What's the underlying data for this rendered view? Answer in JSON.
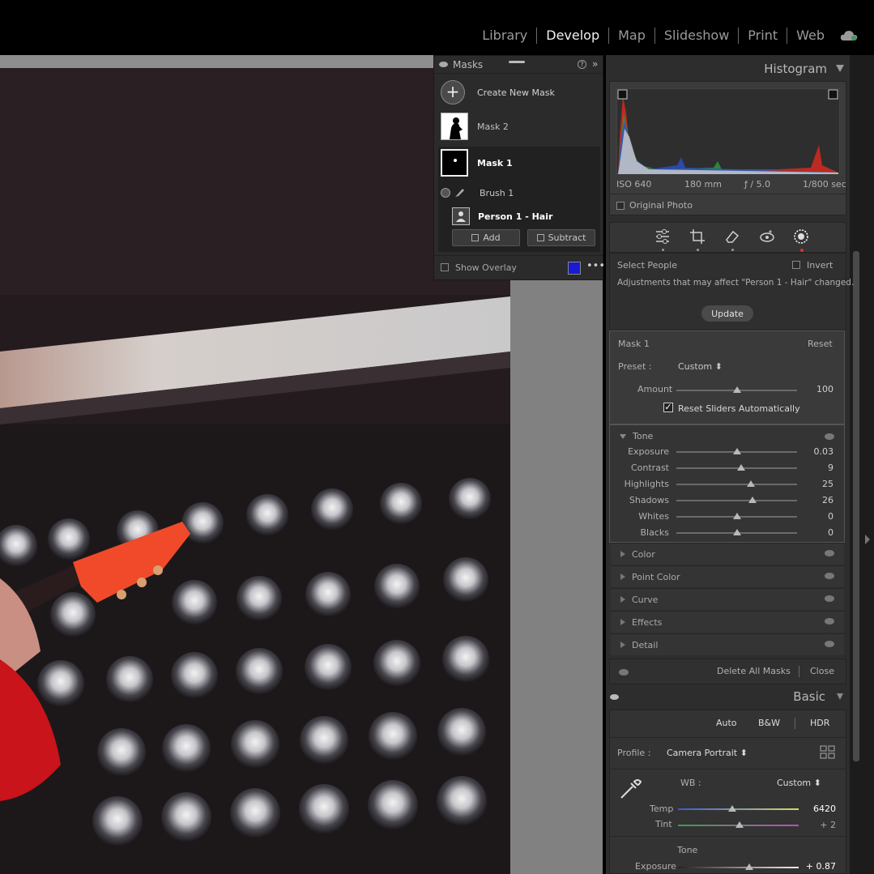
{
  "modules": [
    "Library",
    "Develop",
    "Map",
    "Slideshow",
    "Print",
    "Web"
  ],
  "active_module": "Develop",
  "masks_panel": {
    "title": "Masks",
    "create_label": "Create New Mask",
    "mask2": "Mask 2",
    "mask1": "Mask 1",
    "brush": "Brush 1",
    "person": "Person 1 - Hair",
    "add": "Add",
    "subtract": "Subtract",
    "show_overlay": "Show Overlay",
    "overlay_color": "#1a1ad0"
  },
  "histogram": {
    "title": "Histogram",
    "iso": "ISO 640",
    "focal": "180 mm",
    "aperture": "ƒ / 5.0",
    "shutter": "1/800 sec",
    "original_photo": "Original Photo"
  },
  "select_people": {
    "label": "Select People",
    "invert": "Invert",
    "message": "Adjustments that may affect \"Person 1 - Hair\" changed.",
    "update": "Update"
  },
  "mask_settings": {
    "title": "Mask 1",
    "reset": "Reset",
    "preset_label": "Preset :",
    "preset_value": "Custom",
    "amount_label": "Amount",
    "amount_value": "100",
    "amount_level": 0.5,
    "reset_sliders": "Reset Sliders Automatically"
  },
  "tone": {
    "title": "Tone",
    "sliders": [
      {
        "label": "Exposure",
        "value": "0.03",
        "level": 0.5
      },
      {
        "label": "Contrast",
        "value": "9",
        "level": 0.54
      },
      {
        "label": "Highlights",
        "value": "25",
        "level": 0.62
      },
      {
        "label": "Shadows",
        "value": "26",
        "level": 0.63
      },
      {
        "label": "Whites",
        "value": "0",
        "level": 0.5
      },
      {
        "label": "Blacks",
        "value": "0",
        "level": 0.5
      }
    ]
  },
  "sections": [
    "Color",
    "Point Color",
    "Curve",
    "Effects",
    "Detail"
  ],
  "footer": {
    "delete_all": "Delete All Masks",
    "close": "Close"
  },
  "basic": {
    "title": "Basic",
    "auto": "Auto",
    "bw": "B&W",
    "hdr": "HDR",
    "profile_label": "Profile :",
    "profile_value": "Camera Portrait",
    "wb_label": "WB :",
    "wb_value": "Custom",
    "temp_label": "Temp",
    "temp_value": "6420",
    "temp_level": 0.45,
    "tint_label": "Tint",
    "tint_value": "+ 2",
    "tint_level": 0.51,
    "tone_label": "Tone",
    "exposure_label": "Exposure",
    "exposure_value": "+ 0.87",
    "exposure_level": 0.59
  }
}
